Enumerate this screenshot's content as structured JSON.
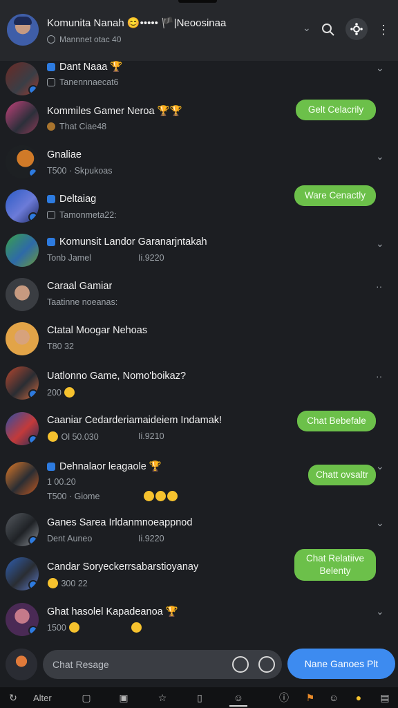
{
  "header": {
    "title": "Komunita Nanah 😊••••• 🏴|Neoosinaa",
    "subtitle": "Mannnet otac 40"
  },
  "chats": [
    {
      "name": "Dant Naaa 🏆",
      "sub": "Tanennnaecat6",
      "extra": "",
      "pill": ""
    },
    {
      "name": "Kommiles Gamer Neroa 🏆🏆",
      "sub": "That Ciae48",
      "extra": "",
      "pill": "Gelt Celacrily"
    },
    {
      "name": "Gnaliae",
      "sub": "T500 · Skpukoas",
      "extra": "",
      "pill": ""
    },
    {
      "name": "Deltaiag",
      "sub": "Tamonmeta22:",
      "extra": "",
      "pill": "Ware Cenactly"
    },
    {
      "name": "Komunsit Landor Garanarjntakah",
      "sub": "Tonb Jamel",
      "extra": "Ii.9220",
      "pill": ""
    },
    {
      "name": "Caraal Gamiar",
      "sub": "Taatinne noeanas:",
      "extra": "",
      "pill": ""
    },
    {
      "name": "Ctatal Moogar Nehoas",
      "sub": "T80 32",
      "extra": "",
      "pill": ""
    },
    {
      "name": "Uatlonno Game, Nomo'boikaz?",
      "sub": "200",
      "extra": "",
      "pill": ""
    },
    {
      "name": "Caaniar Cedarderiamaideiem Indamak!",
      "sub": "Ol 50.030",
      "extra": "Ii.9210",
      "pill": "Chat Bebefale"
    },
    {
      "name": "Dehnalaor leagaole 🏆",
      "sub": "1 00.20",
      "sub2": "T500 · Giome",
      "extra": "",
      "pill": "Chatt ovsaltr"
    },
    {
      "name": "Ganes Sarea Irldanmnoeappnod",
      "sub": "Dent Auneo",
      "extra": "Ii.9220",
      "pill": ""
    },
    {
      "name": "Candar Soryeckerrsabarstioyanay",
      "sub": "300 22",
      "extra": "",
      "pill": "Chat Relatiive Belenty"
    },
    {
      "name": "Ghat hasolel Kapadeanoa 🏆",
      "sub": "1500",
      "extra": "",
      "pill": ""
    }
  ],
  "composer": {
    "placeholder": "Chat Resage",
    "send_label": "Nane Ganoes Plt"
  },
  "bottom_bar": {
    "label": "Alter"
  },
  "colors": {
    "pill_green": "#6cc04a",
    "send_blue": "#3d8bf0",
    "background": "#1c1e22"
  }
}
